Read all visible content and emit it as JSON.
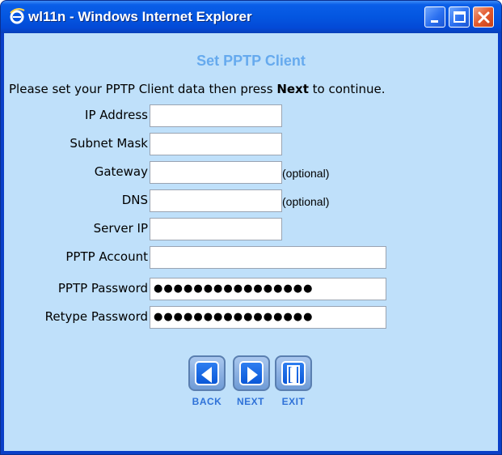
{
  "window": {
    "title": "wl11n - Windows Internet Explorer",
    "icon": "internet-explorer-icon",
    "controls": [
      "minimize-icon",
      "maximize-icon",
      "close-icon"
    ]
  },
  "page": {
    "heading": "Set PPTP Client",
    "instruction_prefix": "Please set your PPTP Client data then press ",
    "instruction_bold": "Next",
    "instruction_suffix": " to continue."
  },
  "form": {
    "ip_address": {
      "label": "IP Address",
      "value": ""
    },
    "subnet_mask": {
      "label": "Subnet Mask",
      "value": ""
    },
    "gateway": {
      "label": "Gateway",
      "value": "",
      "note": "(optional)"
    },
    "dns": {
      "label": "DNS",
      "value": "",
      "note": "(optional)"
    },
    "server_ip": {
      "label": "Server IP",
      "value": ""
    },
    "pptp_account": {
      "label": "PPTP Account",
      "value": ""
    },
    "pptp_password": {
      "label": "PPTP Password",
      "value": "●●●●●●●●●●●●●●●●"
    },
    "retype_password": {
      "label": "Retype Password",
      "value": "●●●●●●●●●●●●●●●●"
    }
  },
  "nav": {
    "back": {
      "label": "BACK",
      "icon": "back-arrow-icon"
    },
    "next": {
      "label": "NEXT",
      "icon": "next-arrow-icon"
    },
    "exit": {
      "label": "EXIT",
      "icon": "exit-door-icon"
    }
  },
  "colors": {
    "titlebar": "#0456e0",
    "client_background": "#bfe0fa",
    "heading": "#66aaee",
    "nav_label": "#2f72d8",
    "close_button": "#e35a2e"
  }
}
